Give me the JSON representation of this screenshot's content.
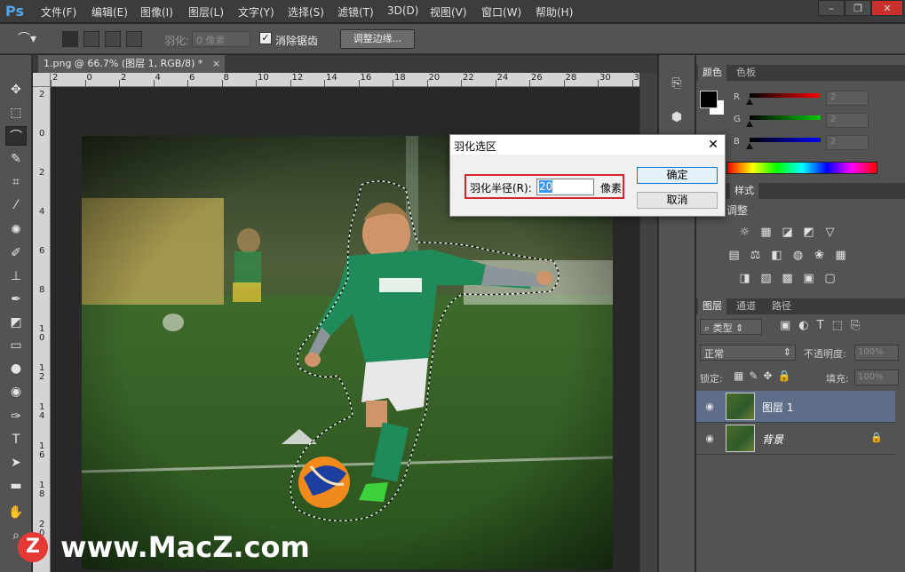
{
  "app": {
    "logo": "Ps"
  },
  "menu": [
    "文件(F)",
    "编辑(E)",
    "图像(I)",
    "图层(L)",
    "文字(Y)",
    "选择(S)",
    "滤镜(T)",
    "3D(D)",
    "视图(V)",
    "窗口(W)",
    "帮助(H)"
  ],
  "window_controls": {
    "minimize": "–",
    "restore": "❐",
    "close": "✕"
  },
  "options": {
    "feather_label": "羽化:",
    "feather_value": "0 像素",
    "antialias_label": "消除锯齿",
    "antialias_checked": true,
    "adjust_edge_label": "调整边缘..."
  },
  "document": {
    "tab_title": "1.png @ 66.7% (图层 1, RGB/8) *",
    "tab_close": "×"
  },
  "rulers": {
    "horizontal": [
      "2",
      "0",
      "2",
      "4",
      "6",
      "8",
      "10",
      "12",
      "14",
      "16",
      "18",
      "20",
      "22",
      "24",
      "26",
      "28",
      "30",
      "32"
    ],
    "vertical": [
      "2",
      "0",
      "2",
      "4",
      "6",
      "8",
      "1\n0",
      "1\n2",
      "1\n4",
      "1\n6",
      "1\n8",
      "2\n0"
    ]
  },
  "color_panel": {
    "tabs": [
      "颜色",
      "色板"
    ],
    "channels": [
      {
        "label": "R",
        "value": "2"
      },
      {
        "label": "G",
        "value": "2"
      },
      {
        "label": "B",
        "value": "2"
      }
    ]
  },
  "adjust_panel": {
    "tabs": [
      "样式"
    ],
    "title": "调整"
  },
  "layers_panel": {
    "tabs": [
      "图层",
      "通道",
      "路径"
    ],
    "filter_kind": "类型",
    "blend_mode": "正常",
    "opacity_label": "不透明度:",
    "opacity_value": "100%",
    "lock_label": "锁定:",
    "fill_label": "填充:",
    "fill_value": "100%",
    "layers": [
      {
        "name": "图层 1",
        "selected": true
      },
      {
        "name": "背景",
        "selected": false,
        "locked": true
      }
    ]
  },
  "dialog": {
    "title": "羽化选区",
    "close": "✕",
    "radius_label": "羽化半径(R):",
    "radius_value": "20",
    "unit": "像素",
    "ok": "确定",
    "cancel": "取消"
  },
  "watermark": {
    "logo": "Z",
    "text": "www.MacZ.com"
  }
}
